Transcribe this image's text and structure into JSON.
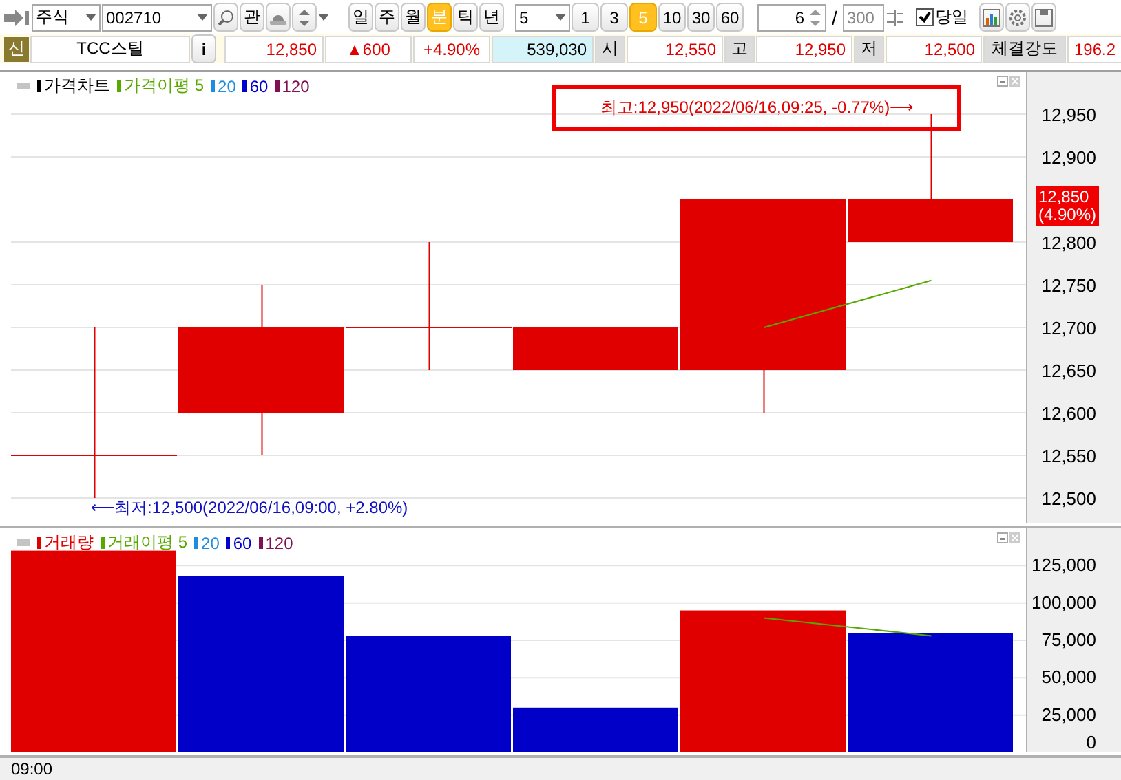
{
  "toolbar": {
    "market_select": "주식",
    "code_field": "002710",
    "watch_button": "관",
    "period_tabs": [
      {
        "label": "일",
        "selected": false
      },
      {
        "label": "주",
        "selected": false
      },
      {
        "label": "월",
        "selected": false
      },
      {
        "label": "분",
        "selected": true
      },
      {
        "label": "틱",
        "selected": false
      },
      {
        "label": "년",
        "selected": false
      }
    ],
    "interval_select": "5",
    "interval_tabs": [
      {
        "label": "1",
        "selected": false
      },
      {
        "label": "3",
        "selected": false
      },
      {
        "label": "5",
        "selected": true
      },
      {
        "label": "10",
        "selected": false
      },
      {
        "label": "30",
        "selected": false
      },
      {
        "label": "60",
        "selected": false
      }
    ],
    "count_field": "6",
    "separator": "/",
    "max_field": "300",
    "today_checkbox": {
      "label": "당일",
      "checked": true
    }
  },
  "quote": {
    "badge": "신",
    "name": "TCC스틸",
    "info_button": "i",
    "price": "12,850",
    "change": "▲600",
    "change_rate": "+4.90%",
    "volume": "539,030",
    "fields": [
      {
        "label": "시",
        "value": "12,550"
      },
      {
        "label": "고",
        "value": "12,950"
      },
      {
        "label": "저",
        "value": "12,500"
      },
      {
        "label": "체결강도",
        "value": "196.2"
      }
    ]
  },
  "price_chart": {
    "legend": [
      {
        "label": "가격차트",
        "color": "#000000"
      },
      {
        "label": "가격이평 5",
        "color": "#58a800"
      },
      {
        "label": "20",
        "color": "#1e8ce0"
      },
      {
        "label": "60",
        "color": "#0000d0"
      },
      {
        "label": "120",
        "color": "#801050"
      }
    ],
    "high_note": "최고:12,950(2022/06/16,09:25, -0.77%)⟶",
    "low_note": "⟵최저:12,500(2022/06/16,09:00, +2.80%)",
    "current_price": "12,850",
    "current_rate": "(4.90%)",
    "chart_data": {
      "type": "line",
      "grid": true,
      "series": [
        {
          "color": "#58a800",
          "values": [
            null,
            null,
            null,
            null,
            12700,
            12755
          ]
        }
      ],
      "ylim": [
        12471,
        13000
      ],
      "yticks": [
        {
          "value": 12950,
          "label": "12,950"
        },
        {
          "value": 12900,
          "label": "12,900"
        },
        {
          "value": 12800,
          "label": "12,800"
        },
        {
          "value": 12750,
          "label": "12,750"
        },
        {
          "value": 12700,
          "label": "12,700"
        },
        {
          "value": 12650,
          "label": "12,650"
        },
        {
          "value": 12600,
          "label": "12,600"
        },
        {
          "value": 12550,
          "label": "12,550"
        },
        {
          "value": 12500,
          "label": "12,500"
        }
      ]
    }
  },
  "volume_chart": {
    "legend": [
      {
        "label": "거래량",
        "color": "#e00000"
      },
      {
        "label": "거래이평 5",
        "color": "#58a800"
      },
      {
        "label": "20",
        "color": "#1e8ce0"
      },
      {
        "label": "60",
        "color": "#0000d0"
      },
      {
        "label": "120",
        "color": "#801050"
      }
    ],
    "chart_data": {
      "type": "bar",
      "stacked": true,
      "grid": true,
      "series": [
        {
          "color": "#e00000",
          "values": [
            135000,
            null,
            null,
            null,
            95000,
            null
          ]
        },
        {
          "color": "#0000c8",
          "values": [
            null,
            118000,
            78000,
            30000,
            null,
            80000
          ]
        },
        {
          "type": "line",
          "color": "#58a800",
          "values": [
            null,
            null,
            null,
            null,
            90000,
            78000
          ]
        }
      ],
      "ylim": [
        0,
        150000
      ],
      "yticks": [
        {
          "value": 125000,
          "label": "125,000"
        },
        {
          "value": 100000,
          "label": "100,000"
        },
        {
          "value": 75000,
          "label": "75,000"
        },
        {
          "value": 50000,
          "label": "50,000"
        },
        {
          "value": 25000,
          "label": "25,000"
        },
        {
          "value": 0,
          "label": "0"
        }
      ]
    }
  },
  "time_axis": [
    "09:00"
  ]
}
